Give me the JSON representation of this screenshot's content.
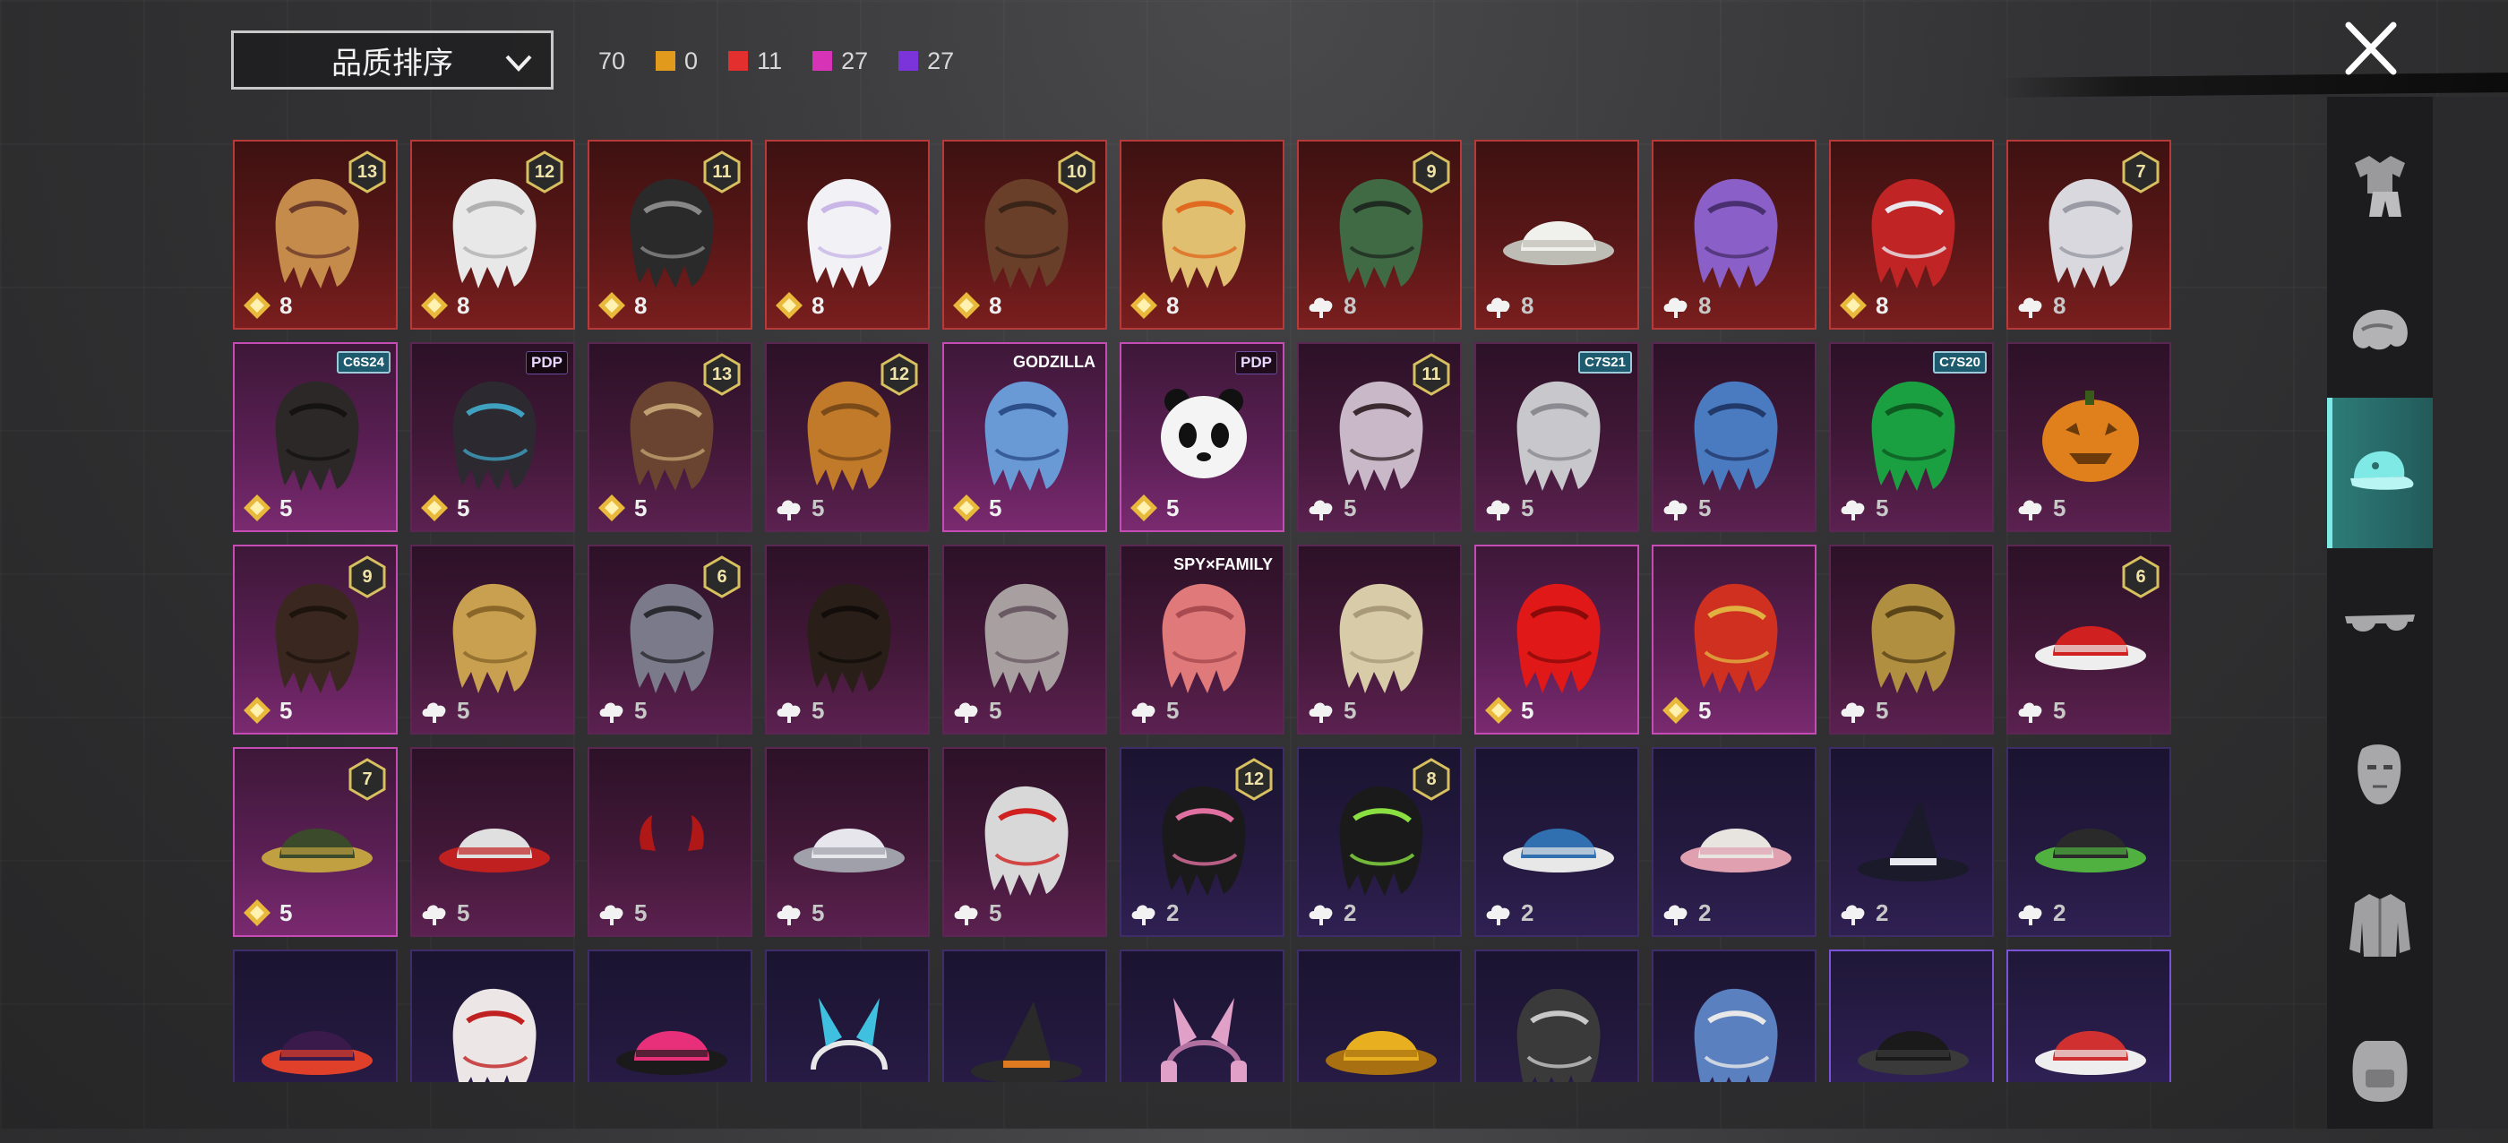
{
  "sort": {
    "label": "品质排序"
  },
  "stats": [
    {
      "value": "70",
      "color": ""
    },
    {
      "value": "0",
      "color": "#e29a1c"
    },
    {
      "value": "11",
      "color": "#e3302f"
    },
    {
      "value": "27",
      "color": "#d633b6"
    },
    {
      "value": "27",
      "color": "#7a34d9"
    }
  ],
  "colors": {
    "accent": "#7fe9e6",
    "active_tab": "#2d7d7a"
  },
  "sidebar": {
    "items": [
      {
        "icon": "outfit-icon"
      },
      {
        "icon": "hair-icon"
      },
      {
        "icon": "cap-icon",
        "active": true
      },
      {
        "icon": "glasses-icon"
      },
      {
        "icon": "mask-icon"
      },
      {
        "icon": "jacket-icon"
      },
      {
        "icon": "backpack-icon"
      }
    ]
  },
  "items": [
    {
      "rarity": "red",
      "art": "hair-hat",
      "badge": "13",
      "currency": "gold",
      "cost": "8"
    },
    {
      "rarity": "red",
      "art": "white-hair",
      "badge": "12",
      "currency": "gold",
      "cost": "8"
    },
    {
      "rarity": "red",
      "art": "black-helmet",
      "badge": "11",
      "currency": "gold",
      "cost": "8"
    },
    {
      "rarity": "red",
      "art": "ghost-hair",
      "badge": "",
      "currency": "gold",
      "cost": "8"
    },
    {
      "rarity": "red",
      "art": "brown-hair",
      "badge": "10",
      "currency": "gold",
      "cost": "8"
    },
    {
      "rarity": "red",
      "art": "skull-mask",
      "badge": "",
      "currency": "gold",
      "cost": "8"
    },
    {
      "rarity": "red",
      "art": "green-face",
      "badge": "9",
      "currency": "silver",
      "cost": "8"
    },
    {
      "rarity": "red",
      "art": "white-cowboy-hat",
      "badge": "",
      "currency": "silver",
      "cost": "8"
    },
    {
      "rarity": "red",
      "art": "purple-hair",
      "badge": "",
      "currency": "silver",
      "cost": "8"
    },
    {
      "rarity": "red",
      "art": "red-demon-mask",
      "badge": "",
      "currency": "gold",
      "cost": "8"
    },
    {
      "rarity": "red",
      "art": "silver-long-hair",
      "badge": "7",
      "currency": "silver",
      "cost": "8"
    },
    {
      "rarity": "magenta-hi",
      "art": "dark-bob",
      "tag": "C6S24",
      "tagStyle": "hex",
      "currency": "gold",
      "cost": "5"
    },
    {
      "rarity": "magenta",
      "art": "dark-bob-ribbon",
      "tag": "PDP",
      "tagStyle": "brand",
      "currency": "gold",
      "cost": "5"
    },
    {
      "rarity": "magenta",
      "art": "goggle-cap",
      "badge": "13",
      "currency": "gold",
      "cost": "5"
    },
    {
      "rarity": "magenta",
      "art": "ginger-hair",
      "badge": "12",
      "currency": "silver",
      "cost": "5"
    },
    {
      "rarity": "magenta-hi",
      "art": "blue-hair",
      "tag": "GODZILLA",
      "tagStyle": "text",
      "currency": "gold",
      "cost": "5"
    },
    {
      "rarity": "magenta-hi",
      "art": "panda-head",
      "tag": "PDP",
      "tagStyle": "brand",
      "currency": "gold",
      "cost": "5"
    },
    {
      "rarity": "magenta",
      "art": "flower-hair",
      "badge": "11",
      "currency": "silver",
      "cost": "5"
    },
    {
      "rarity": "magenta",
      "art": "silver-swept",
      "tag": "C7S21",
      "tagStyle": "hex",
      "currency": "silver",
      "cost": "5"
    },
    {
      "rarity": "magenta",
      "art": "blue-tentacle",
      "badge": "",
      "currency": "silver",
      "cost": "5"
    },
    {
      "rarity": "magenta",
      "art": "green-hair",
      "tag": "C7S20",
      "tagStyle": "hex",
      "currency": "silver",
      "cost": "5"
    },
    {
      "rarity": "magenta",
      "art": "pumpkin",
      "badge": "",
      "currency": "silver",
      "cost": "5"
    },
    {
      "rarity": "magenta-hi",
      "art": "dark-pony",
      "badge": "9",
      "currency": "gold",
      "cost": "5"
    },
    {
      "rarity": "magenta",
      "art": "blonde-long",
      "badge": "",
      "currency": "silver",
      "cost": "5"
    },
    {
      "rarity": "magenta",
      "art": "knight-helmet",
      "badge": "6",
      "currency": "silver",
      "cost": "5"
    },
    {
      "rarity": "magenta",
      "art": "dark-long",
      "badge": "",
      "currency": "silver",
      "cost": "5"
    },
    {
      "rarity": "magenta",
      "art": "grey-bonnet",
      "badge": "",
      "currency": "silver",
      "cost": "5"
    },
    {
      "rarity": "magenta",
      "art": "pink-hair",
      "tag": "SPY×FAMILY",
      "tagStyle": "text",
      "currency": "silver",
      "cost": "5"
    },
    {
      "rarity": "magenta",
      "art": "blonde-curls",
      "badge": "",
      "currency": "silver",
      "cost": "5"
    },
    {
      "rarity": "magenta-hi",
      "art": "red-hair",
      "badge": "",
      "currency": "gold",
      "cost": "5"
    },
    {
      "rarity": "magenta-hi",
      "art": "dragon-mask",
      "badge": "",
      "currency": "gold",
      "cost": "5"
    },
    {
      "rarity": "magenta",
      "art": "gold-helmet",
      "badge": "",
      "currency": "silver",
      "cost": "5"
    },
    {
      "rarity": "magenta",
      "art": "santa-hat",
      "badge": "6",
      "currency": "silver",
      "cost": "5"
    },
    {
      "rarity": "magenta-hi",
      "art": "military-cap",
      "badge": "7",
      "currency": "gold",
      "cost": "5"
    },
    {
      "rarity": "magenta",
      "art": "vr-visor",
      "badge": "",
      "currency": "silver",
      "cost": "5"
    },
    {
      "rarity": "magenta",
      "art": "devil-horns",
      "badge": "",
      "currency": "silver",
      "cost": "5"
    },
    {
      "rarity": "magenta",
      "art": "white-sunhat",
      "badge": "",
      "currency": "silver",
      "cost": "5"
    },
    {
      "rarity": "magenta",
      "art": "chicken-head",
      "badge": "",
      "currency": "silver",
      "cost": "5"
    },
    {
      "rarity": "purple",
      "art": "bunny-cap",
      "badge": "12",
      "currency": "silver",
      "cost": "2"
    },
    {
      "rarity": "purple",
      "art": "green-skull-hair",
      "badge": "8",
      "currency": "silver",
      "cost": "2"
    },
    {
      "rarity": "purple",
      "art": "baseball-cap",
      "badge": "",
      "currency": "silver",
      "cost": "2"
    },
    {
      "rarity": "purple",
      "art": "flower-sunhat",
      "badge": "",
      "currency": "silver",
      "cost": "2"
    },
    {
      "rarity": "purple",
      "art": "witch-hat",
      "badge": "",
      "currency": "silver",
      "cost": "2"
    },
    {
      "rarity": "purple",
      "art": "green-cap",
      "badge": "",
      "currency": "silver",
      "cost": "2"
    },
    {
      "rarity": "purple",
      "art": "purple-tophat",
      "badge": "",
      "currency": "",
      "cost": ""
    },
    {
      "rarity": "purple",
      "art": "clown-mask",
      "badge": "",
      "currency": "",
      "cost": ""
    },
    {
      "rarity": "purple",
      "art": "pink-cap",
      "badge": "",
      "currency": "",
      "cost": ""
    },
    {
      "rarity": "purple",
      "art": "bunny-ears",
      "badge": "",
      "currency": "",
      "cost": ""
    },
    {
      "rarity": "purple",
      "art": "wizard-hat",
      "badge": "",
      "currency": "",
      "cost": ""
    },
    {
      "rarity": "purple",
      "art": "cat-headphones",
      "badge": "",
      "currency": "",
      "cost": ""
    },
    {
      "rarity": "purple",
      "art": "yellow-bucket-hat",
      "badge": "",
      "currency": "",
      "cost": ""
    },
    {
      "rarity": "purple",
      "art": "silver-helmet",
      "badge": "",
      "currency": "",
      "cost": ""
    },
    {
      "rarity": "purple",
      "art": "shark-hat",
      "badge": "",
      "currency": "",
      "cost": ""
    },
    {
      "rarity": "purple-hi",
      "art": "black-fedora",
      "badge": "",
      "currency": "",
      "cost": ""
    },
    {
      "rarity": "purple-hi",
      "art": "red-fedora",
      "badge": "",
      "currency": "",
      "cost": ""
    }
  ]
}
